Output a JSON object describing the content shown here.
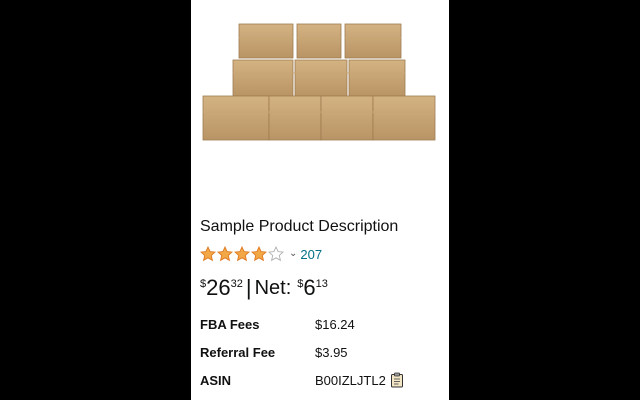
{
  "product": {
    "title": "Sample Product Description",
    "image_icon": "cardboard-boxes-stack-image",
    "rating": {
      "stars": 4,
      "max_stars": 5,
      "count": "207",
      "star_color": "#F3A847"
    },
    "price": {
      "currency": "$",
      "main": "26",
      "cents": "32",
      "separator": "|",
      "net_label": "Net:",
      "net_main": "6",
      "net_cents": "13"
    },
    "details": [
      {
        "label": "FBA Fees",
        "value": "$16.24"
      },
      {
        "label": "Referral Fee",
        "value": "$3.95"
      },
      {
        "label": "ASIN",
        "value": "B00IZLJTL2"
      }
    ]
  },
  "colors": {
    "background": "#000000",
    "card": "#FFFFFF",
    "link": "#007185",
    "box_brown": "#C9A675"
  }
}
